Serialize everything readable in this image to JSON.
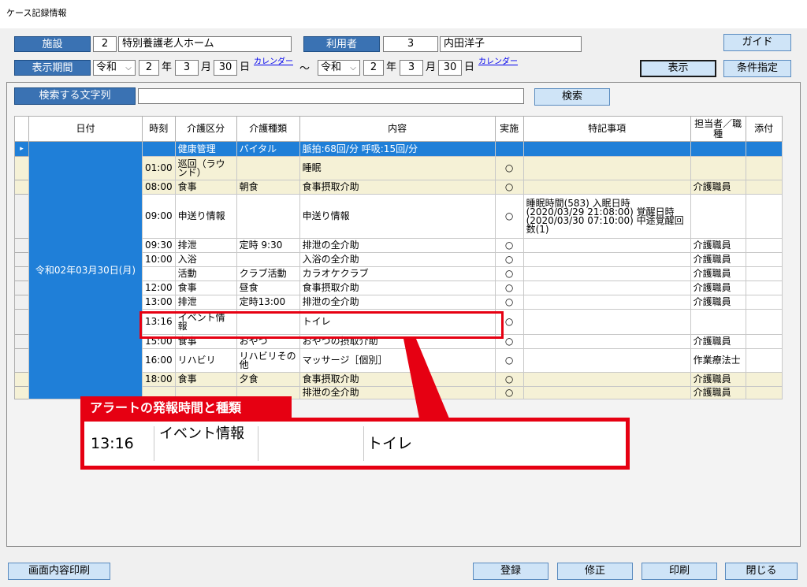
{
  "window": {
    "title": "ケース記録情報"
  },
  "header": {
    "facility_label": "施設",
    "facility_code": "2",
    "facility_name": "特別養護老人ホーム",
    "user_label": "利用者",
    "user_code": "3",
    "user_name": "内田洋子",
    "period_label": "表示期間",
    "from": {
      "era": "令和",
      "year": "2",
      "month": "3",
      "day": "30"
    },
    "to": {
      "era": "令和",
      "year": "2",
      "month": "3",
      "day": "30"
    },
    "year_unit": "年",
    "month_unit": "月",
    "day_unit": "日",
    "calendar_link": "カレンダー",
    "tilde": "～",
    "guide_button": "ガイド",
    "show_button": "表示",
    "condition_button": "条件指定"
  },
  "search": {
    "label": "検索する文字列",
    "value": "",
    "button": "検索"
  },
  "grid": {
    "columns": [
      "日付",
      "時刻",
      "介護区分",
      "介護種類",
      "内容",
      "実施",
      "特記事項",
      "担当者／職種",
      "添付"
    ],
    "date_cell": "令和02年03月30日(月)",
    "row_indicator": "▸",
    "rows": [
      {
        "time": "",
        "category": "健康管理",
        "type": "バイタル",
        "content": "脈拍:68回/分 呼吸:15回/分",
        "done": "",
        "notes": "",
        "staff": "",
        "attach": ""
      },
      {
        "time": "01:00",
        "category": "巡回（ラウンド）",
        "type": "",
        "content": "睡眠",
        "done": "○",
        "notes": "",
        "staff": "",
        "attach": ""
      },
      {
        "time": "08:00",
        "category": "食事",
        "type": "朝食",
        "content": "食事摂取介助",
        "done": "○",
        "notes": "",
        "staff": "介護職員",
        "attach": ""
      },
      {
        "time": "09:00",
        "category": "申送り情報",
        "type": "",
        "content": "申送り情報",
        "done": "○",
        "notes": "睡眠時間(583) 入眠日時(2020/03/29 21:08:00) 覚醒日時(2020/03/30 07:10:00) 中途覚醒回数(1)",
        "staff": "",
        "attach": ""
      },
      {
        "time": "09:30",
        "category": "排泄",
        "type": "定時 9:30",
        "content": "排泄の全介助",
        "done": "○",
        "notes": "",
        "staff": "介護職員",
        "attach": ""
      },
      {
        "time": "10:00",
        "category": "入浴",
        "type": "",
        "content": "入浴の全介助",
        "done": "○",
        "notes": "",
        "staff": "介護職員",
        "attach": ""
      },
      {
        "time": "",
        "category": "活動",
        "type": "クラブ活動",
        "content": "カラオケクラブ",
        "done": "○",
        "notes": "",
        "staff": "介護職員",
        "attach": ""
      },
      {
        "time": "12:00",
        "category": "食事",
        "type": "昼食",
        "content": "食事摂取介助",
        "done": "○",
        "notes": "",
        "staff": "介護職員",
        "attach": ""
      },
      {
        "time": "13:00",
        "category": "排泄",
        "type": "定時13:00",
        "content": "排泄の全介助",
        "done": "○",
        "notes": "",
        "staff": "介護職員",
        "attach": ""
      },
      {
        "time": "13:16",
        "category": "イベント情報",
        "type": "",
        "content": "トイレ",
        "done": "○",
        "notes": "",
        "staff": "",
        "attach": ""
      },
      {
        "time": "15:00",
        "category": "食事",
        "type": "おやつ",
        "content": "おやつの摂取介助",
        "done": "○",
        "notes": "",
        "staff": "介護職員",
        "attach": ""
      },
      {
        "time": "16:00",
        "category": "リハビリ",
        "type": "リハビリその他",
        "content": "マッサージ［個別］",
        "done": "○",
        "notes": "",
        "staff": "作業療法士",
        "attach": ""
      },
      {
        "time": "18:00",
        "category": "食事",
        "type": "夕食",
        "content": "食事摂取介助",
        "done": "○",
        "notes": "",
        "staff": "介護職員",
        "attach": ""
      },
      {
        "time": "",
        "category": "",
        "type": "",
        "content": "排泄の全介助",
        "done": "○",
        "notes": "",
        "staff": "介護職員",
        "attach": ""
      }
    ]
  },
  "callout": {
    "title": "アラートの発報時間と種類",
    "time": "13:16",
    "category": "イベント情報",
    "content": "トイレ",
    "color": "#e60012"
  },
  "footer": {
    "print_screen": "画面内容印刷",
    "register": "登録",
    "edit": "修正",
    "print": "印刷",
    "close": "閉じる"
  },
  "colors": {
    "accent": "#3a72b3",
    "selection": "#1f7fd8",
    "button_bg": "#cfe4f7",
    "alert": "#e60012",
    "cream": "#f5f1d6"
  }
}
